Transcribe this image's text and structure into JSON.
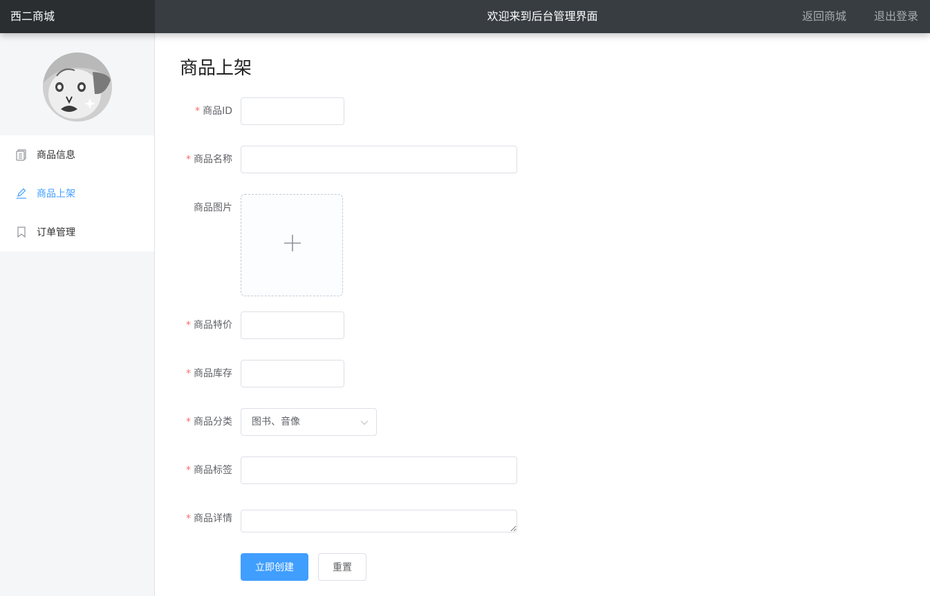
{
  "header": {
    "brand": "西二商城",
    "title": "欢迎来到后台管理界面",
    "back_link": "返回商城",
    "logout_link": "退出登录"
  },
  "sidebar": {
    "items": [
      {
        "label": "商品信息",
        "icon": "document-icon",
        "active": false
      },
      {
        "label": "商品上架",
        "icon": "edit-icon",
        "active": true
      },
      {
        "label": "订单管理",
        "icon": "bookmark-icon",
        "active": false
      }
    ]
  },
  "page": {
    "title": "商品上架",
    "required_mark": "*",
    "fields": {
      "id": {
        "label": "商品ID",
        "value": ""
      },
      "name": {
        "label": "商品名称",
        "value": ""
      },
      "image": {
        "label": "商品图片"
      },
      "price": {
        "label": "商品特价",
        "value": ""
      },
      "stock": {
        "label": "商品库存",
        "value": ""
      },
      "category": {
        "label": "商品分类",
        "value": "图书、音像"
      },
      "tags": {
        "label": "商品标签",
        "value": ""
      },
      "detail": {
        "label": "商品详情",
        "value": ""
      }
    },
    "buttons": {
      "create": "立即创建",
      "reset": "重置"
    }
  },
  "colors": {
    "header_bg": "#373d41",
    "brand_bg": "#2a2e31",
    "accent": "#409eff",
    "required": "#f56c6c",
    "sidebar_bg": "#f5f6f8"
  }
}
